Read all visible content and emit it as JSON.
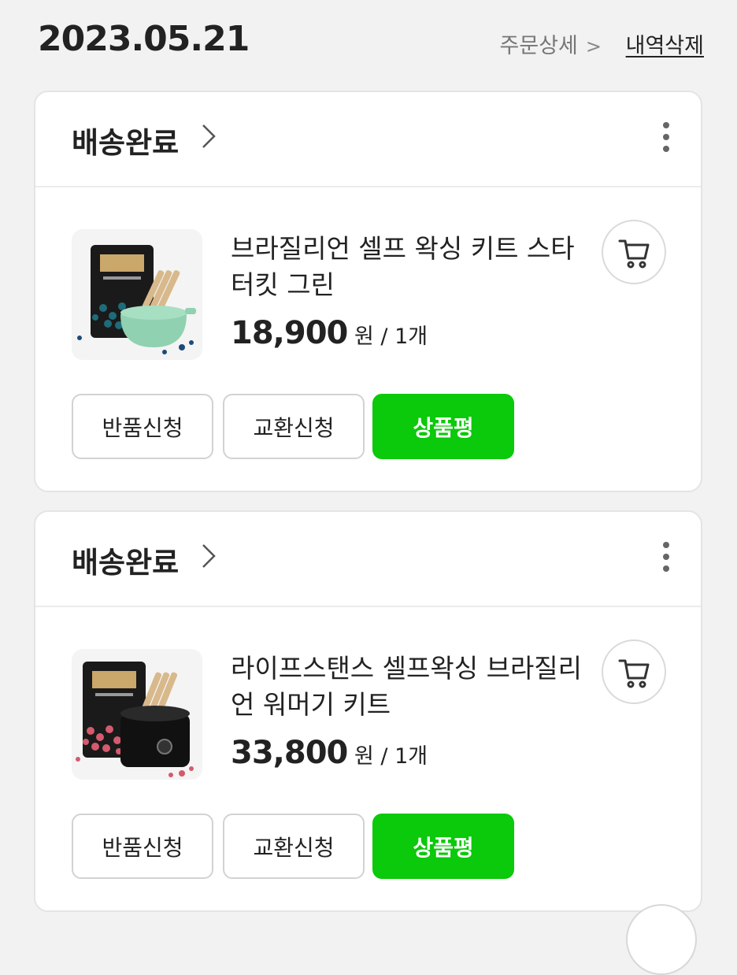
{
  "order": {
    "date": "2023.05.21",
    "detail_label": "주문상세",
    "detail_chevron": ">",
    "delete_label": "내역삭제"
  },
  "items": [
    {
      "status": "배송완료",
      "name": "브라질리언 셀프 왁싱 키트 스타터킷 그린",
      "price": "18,900",
      "price_unit": "원",
      "quantity": "/ 1개",
      "buttons": {
        "return": "반품신청",
        "exchange": "교환신청",
        "review": "상품평"
      },
      "product_color": "green"
    },
    {
      "status": "배송완료",
      "name": "라이프스탠스 셀프왁싱 브라질리언 워머기 키트",
      "price": "33,800",
      "price_unit": "원",
      "quantity": "/ 1개",
      "buttons": {
        "return": "반품신청",
        "exchange": "교환신청",
        "review": "상품평"
      },
      "product_color": "pink"
    }
  ],
  "icons": {
    "status_chevron": "chevron-right-icon",
    "more": "more-vertical-icon",
    "cart": "cart-icon"
  },
  "colors": {
    "accent": "#0bc90b",
    "background": "#f2f2f2",
    "card": "#ffffff"
  }
}
